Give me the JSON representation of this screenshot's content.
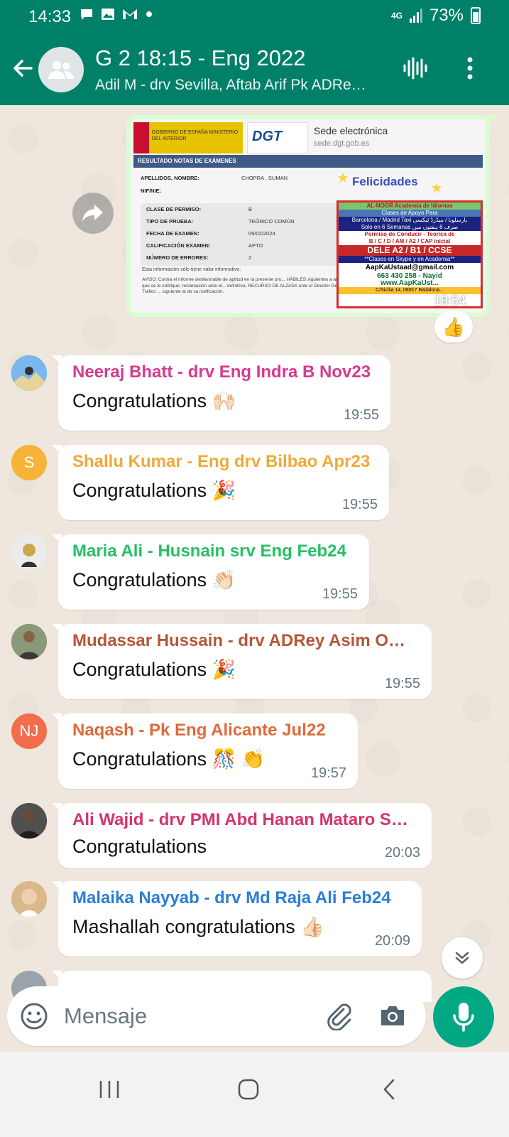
{
  "status": {
    "time": "14:33",
    "network": "4G",
    "battery": "73%",
    "notification_icons": [
      "chat-bubble-icon",
      "image-icon",
      "gmail-icon",
      "dot"
    ]
  },
  "header": {
    "title": "G 2 18:15 - Eng 2022",
    "subtitle": "Adil M - drv Sevilla, Aftab Arif Pk ADRe…"
  },
  "image_message": {
    "time": "19:54",
    "reaction": "👍",
    "document": {
      "gov_text": "GOBIERNO DE ESPAÑA    MINISTERIO DEL INTERIOR",
      "dgt_logo": "DGT",
      "sede": "Sede electrónica",
      "sede_url": "sede.dgt.gob.es",
      "band": "RESULTADO NOTAS DE EXÁMENES",
      "name_label": "APELLIDOS, NOMBRE:",
      "name_value": "CHOPRA , SUMAN",
      "nif_label": "NIF/NIE:",
      "clase_label": "CLASE DE PERMISO:",
      "clase_value": "B",
      "tipo_label": "TIPO DE PRUEBA:",
      "tipo_value": "TEÓRICO COMÚN",
      "fecha_label": "FECHA DE EXAMEN:",
      "fecha_value": "09/02/2024",
      "calif_label": "CALIFICACIÓN EXAMEN:",
      "calif_value": "APTO",
      "errores_label": "NÚMERO DE ERRORES:",
      "errores_value": "2",
      "note": "Esta información sólo tiene valor informativo.",
      "aviso": "AVISO: Contra el informe desfavorable de aptitud en la presente pru... HÁBILES siguientes a aquél en que se le notifique, reclamación ante el... definitiva, RECURSO DE ALZADA ante el Director General de Tráfico ... siguiente al de su notificación.",
      "felicidades": "Felicidades",
      "ad": {
        "line1": "AL-NOOR   Academia de Idiomas",
        "line2": "Clases de Apoyo Para",
        "line3": "Barcelona / Madrid Taxi  بارسلونا / میڈرڈ ٹیکسی",
        "line4": "Solo en 6 Semanas   صرف 6 ہفتوں میں",
        "line5": "Permiso de Conducir - Teorica de",
        "line6": "B / C / D / AM / A2 / CAP inicial",
        "line7": "DELE A2  /  B1  /  CCSE",
        "line8": "**Clases en Skype y en Academia**",
        "line9": "AapKaUstaad@gmail.com",
        "line10": "663 430 258  -  Nayid",
        "line11": "www.AapKaUst...",
        "line12": "C/Sicilia 14, 08917 Badalona..."
      }
    }
  },
  "messages": [
    {
      "author": "Neeraj Bhatt - drv Eng Indra B Nov23",
      "text": "Congratulations 🙌🏻",
      "time": "19:55",
      "color": "#d63a8e"
    },
    {
      "author": "Shallu Kumar - Eng drv Bilbao Apr23",
      "text": "Congratulations 🎉",
      "time": "19:55",
      "color": "#f0a93a",
      "initial": "S"
    },
    {
      "author": "Maria Ali - Husnain srv Eng Feb24",
      "text": "Congratulations 👏🏻",
      "time": "19:55",
      "color": "#25c063"
    },
    {
      "author": "Mudassar Hussain - drv ADRey Asim O…",
      "text": "Congratulations 🎉",
      "time": "19:55",
      "color": "#b5563a"
    },
    {
      "author": "Naqash - Pk Eng Alicante Jul22",
      "text": "Congratulations 🎊 👏",
      "time": "19:57",
      "color": "#e06a3a",
      "initial": "NJ"
    },
    {
      "author": "Ali Wajid - drv PMI Abd Hanan Mataro S…",
      "text": "Congratulations",
      "time": "20:03",
      "color": "#d6336c"
    },
    {
      "author": "Malaika Nayyab - drv Md Raja Ali Feb24",
      "text": "Mashallah congratulations 👍🏻",
      "time": "20:09",
      "color": "#2a7ed6"
    }
  ],
  "input": {
    "placeholder": "Mensaje"
  }
}
